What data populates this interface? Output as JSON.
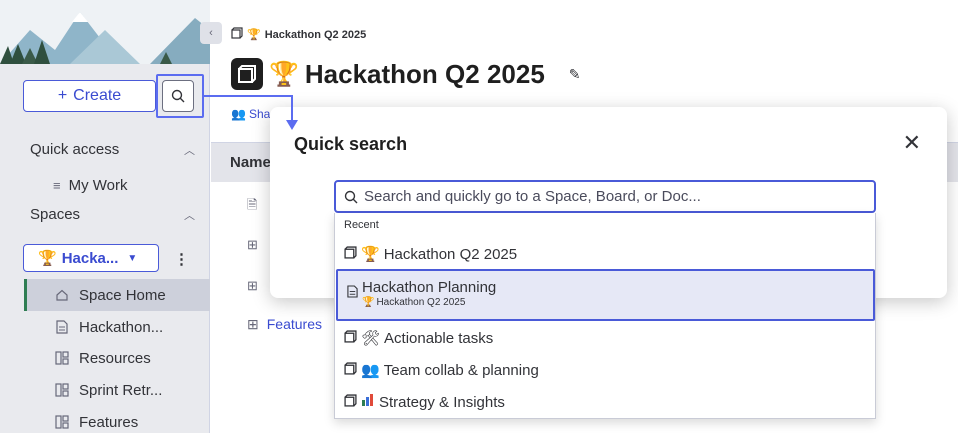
{
  "sidebar": {
    "create_label": "Create",
    "quick_access": "Quick access",
    "my_work": "My Work",
    "spaces": "Spaces",
    "space_selector": "Hacka...",
    "items": [
      {
        "label": "Space Home",
        "icon": "home-icon"
      },
      {
        "label": "Hackathon...",
        "icon": "doc-icon"
      },
      {
        "label": "Resources",
        "icon": "board-icon"
      },
      {
        "label": "Sprint Retr...",
        "icon": "board-icon"
      },
      {
        "label": "Features",
        "icon": "board-icon"
      }
    ]
  },
  "main": {
    "breadcrumb": "Hackathon Q2 2025",
    "title": "Hackathon Q2 2025",
    "share": "Sha",
    "table_header": "Name",
    "features_row": "Features"
  },
  "quick_search": {
    "title": "Quick search",
    "placeholder": "Search and quickly go to a Space, Board, or Doc...",
    "recent_label": "Recent",
    "results": [
      {
        "label": "Hackathon Q2 2025",
        "icon": "trophy-icon"
      },
      {
        "label": "Hackathon Planning",
        "sub": "Hackathon Q2 2025",
        "icon": "doc-icon"
      },
      {
        "label": "Actionable tasks",
        "icon": "tools-icon"
      },
      {
        "label": "Team collab & planning",
        "icon": "people-icon"
      },
      {
        "label": "Strategy & Insights",
        "icon": "chart-icon"
      }
    ]
  },
  "colors": {
    "accent": "#4a5ad8",
    "sidebar_bg": "#e9eaee",
    "active_marker": "#2e7d52"
  }
}
